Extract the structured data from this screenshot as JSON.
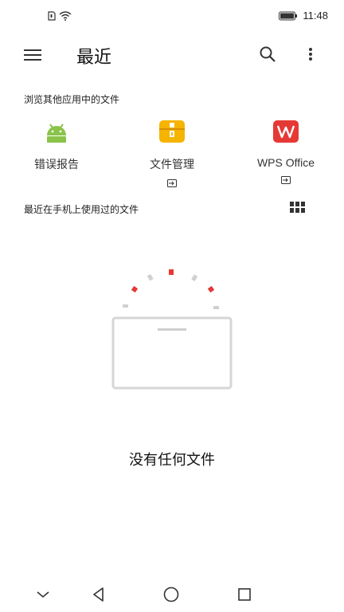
{
  "status_bar": {
    "time": "11:48",
    "icons": [
      "sim-card-icon",
      "wifi-icon",
      "battery-icon"
    ]
  },
  "app_bar": {
    "title": "最近",
    "icons": [
      "menu-icon",
      "search-icon",
      "more-vertical-icon"
    ]
  },
  "browse_section": {
    "title": "浏览其他应用中的文件",
    "sources": [
      {
        "label": "错误报告",
        "icon": "android-icon",
        "external": false
      },
      {
        "label": "文件管理",
        "icon": "file-manager-icon",
        "external": true
      },
      {
        "label": "WPS Office",
        "icon": "wps-icon",
        "external": true
      }
    ]
  },
  "recent_section": {
    "title": "最近在手机上使用过的文件",
    "view_toggle_icon": "grid-view-icon"
  },
  "empty_state": {
    "message": "没有任何文件"
  },
  "nav_bar": {
    "icons": [
      "chevron-down-icon",
      "back-icon",
      "home-icon",
      "recents-icon"
    ]
  },
  "colors": {
    "android_green": "#8bc34a",
    "file_manager_yellow": "#f4b400",
    "wps_red": "#e53935",
    "accent_red": "#e53935"
  }
}
